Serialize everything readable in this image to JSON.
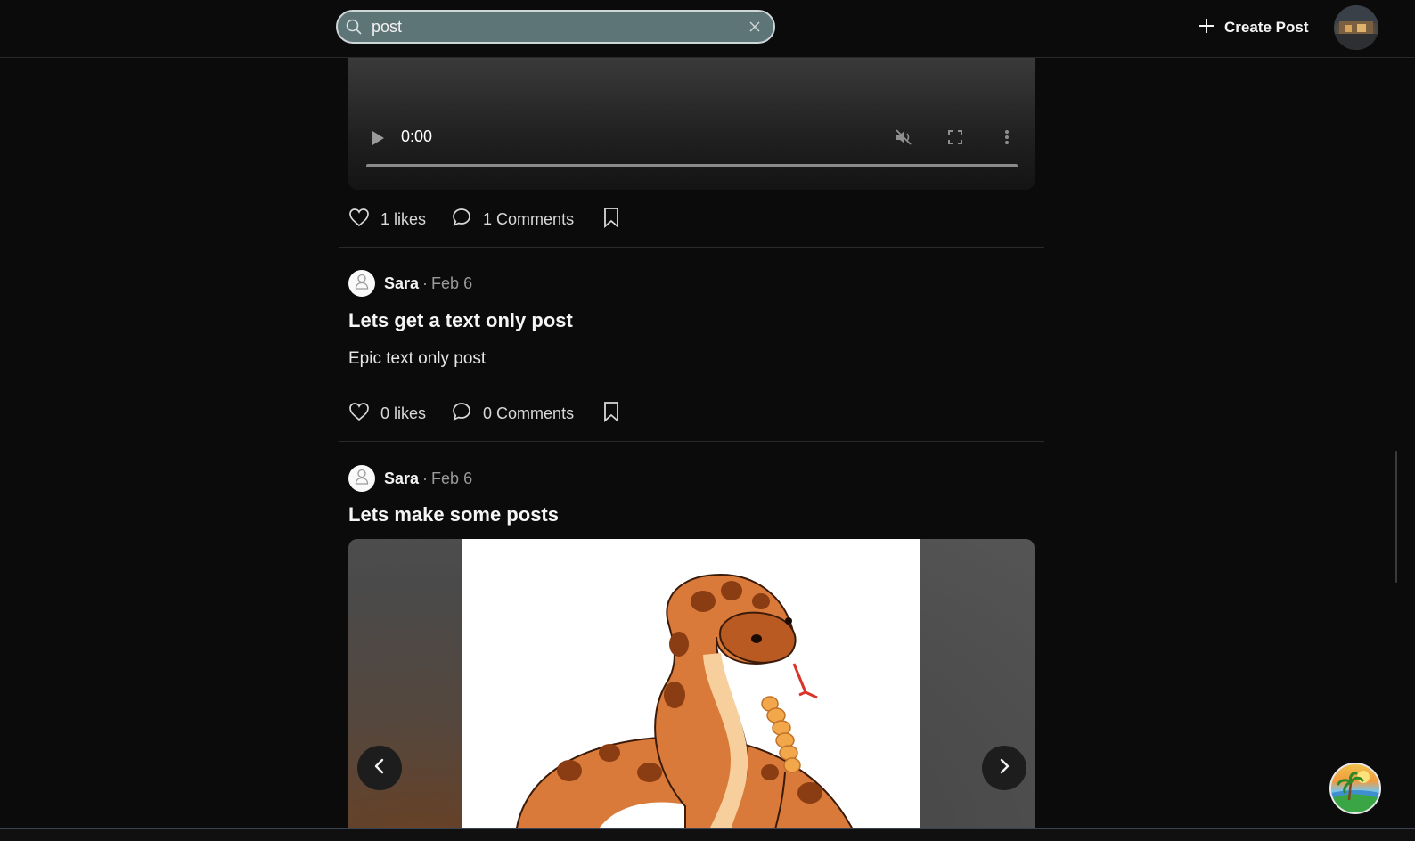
{
  "header": {
    "search": {
      "value": "post",
      "placeholder": ""
    },
    "create_post_label": "Create Post"
  },
  "video": {
    "time": "0:00"
  },
  "posts": [
    {
      "likes": "1 likes",
      "comments": "1 Comments"
    },
    {
      "author": "Sara",
      "separator": "·",
      "date": "Feb 6",
      "title": "Lets get a text only post",
      "body": "Epic text only post",
      "likes": "0 likes",
      "comments": "0 Comments"
    },
    {
      "author": "Sara",
      "separator": "·",
      "date": "Feb 6",
      "title": "Lets make some posts"
    }
  ],
  "colors": {
    "background": "#0b0b0b",
    "search_fill": "#5e7577",
    "search_border": "#cfd6d8",
    "snake_orange": "#d97a3a",
    "snake_spot": "#8a3d12"
  },
  "icons": [
    "search-icon",
    "close-icon",
    "plus-icon",
    "play-icon",
    "mute-icon",
    "fullscreen-icon",
    "more-vertical-icon",
    "heart-icon",
    "comment-icon",
    "bookmark-icon",
    "user-icon",
    "chevron-left-icon",
    "chevron-right-icon"
  ]
}
